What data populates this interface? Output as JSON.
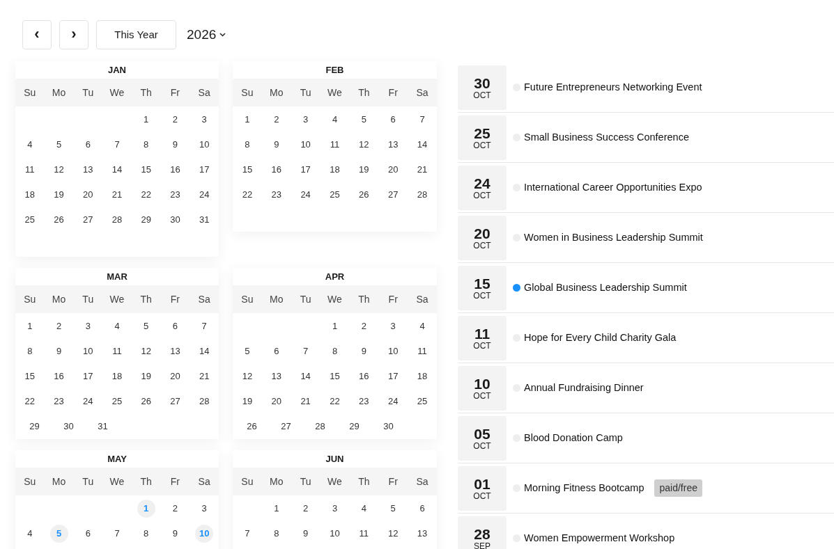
{
  "toolbar": {
    "prev_label": "‹",
    "next_label": "›",
    "today_button": "This Year",
    "year": "2026"
  },
  "months": [
    {
      "name": "JAN",
      "weekdays": [
        "Su",
        "Mo",
        "Tu",
        "We",
        "Th",
        "Fr",
        "Sa"
      ],
      "weeks": [
        [
          {
            "d": "1",
            "marked": false
          },
          {
            "d": "2",
            "marked": false
          },
          {
            "d": "3",
            "marked": false
          }
        ],
        [
          {
            "d": "4",
            "marked": false
          },
          {
            "d": "5",
            "marked": false
          },
          {
            "d": "6",
            "marked": false
          },
          {
            "d": "7",
            "marked": false
          },
          {
            "d": "8",
            "marked": false
          },
          {
            "d": "9",
            "marked": false
          },
          {
            "d": "10",
            "marked": false
          }
        ],
        [
          {
            "d": "11",
            "marked": false
          },
          {
            "d": "12",
            "marked": false
          },
          {
            "d": "13",
            "marked": false
          },
          {
            "d": "14",
            "marked": false
          },
          {
            "d": "15",
            "marked": false
          },
          {
            "d": "16",
            "marked": false
          },
          {
            "d": "17",
            "marked": false
          }
        ],
        [
          {
            "d": "18",
            "marked": false
          },
          {
            "d": "19",
            "marked": false
          },
          {
            "d": "20",
            "marked": false
          },
          {
            "d": "21",
            "marked": false
          },
          {
            "d": "22",
            "marked": false
          },
          {
            "d": "23",
            "marked": false
          },
          {
            "d": "24",
            "marked": false
          }
        ],
        [
          {
            "d": "25",
            "marked": false
          },
          {
            "d": "26",
            "marked": false
          },
          {
            "d": "27",
            "marked": false
          },
          {
            "d": "28",
            "marked": false
          },
          {
            "d": "29",
            "marked": false
          },
          {
            "d": "30",
            "marked": false
          },
          {
            "d": "31",
            "marked": false
          }
        ]
      ]
    },
    {
      "name": "FEB",
      "weekdays": [
        "Su",
        "Mo",
        "Tu",
        "We",
        "Th",
        "Fr",
        "Sa"
      ],
      "weeks": [
        [
          {
            "d": "1",
            "marked": false
          },
          {
            "d": "2",
            "marked": false
          },
          {
            "d": "3",
            "marked": false
          },
          {
            "d": "4",
            "marked": false
          },
          {
            "d": "5",
            "marked": false
          },
          {
            "d": "6",
            "marked": false
          },
          {
            "d": "7",
            "marked": false
          }
        ],
        [
          {
            "d": "8",
            "marked": false
          },
          {
            "d": "9",
            "marked": false
          },
          {
            "d": "10",
            "marked": false
          },
          {
            "d": "11",
            "marked": false
          },
          {
            "d": "12",
            "marked": false
          },
          {
            "d": "13",
            "marked": false
          },
          {
            "d": "14",
            "marked": false
          }
        ],
        [
          {
            "d": "15",
            "marked": false
          },
          {
            "d": "16",
            "marked": false
          },
          {
            "d": "17",
            "marked": false
          },
          {
            "d": "18",
            "marked": false
          },
          {
            "d": "19",
            "marked": false
          },
          {
            "d": "20",
            "marked": false
          },
          {
            "d": "21",
            "marked": false
          }
        ],
        [
          {
            "d": "22",
            "marked": false
          },
          {
            "d": "23",
            "marked": false
          },
          {
            "d": "24",
            "marked": false
          },
          {
            "d": "25",
            "marked": false
          },
          {
            "d": "26",
            "marked": false
          },
          {
            "d": "27",
            "marked": false
          },
          {
            "d": "28",
            "marked": false
          }
        ]
      ]
    },
    {
      "name": "MAR",
      "weekdays": [
        "Su",
        "Mo",
        "Tu",
        "We",
        "Th",
        "Fr",
        "Sa"
      ],
      "weeks": [
        [
          {
            "d": "1",
            "marked": false
          },
          {
            "d": "2",
            "marked": false
          },
          {
            "d": "3",
            "marked": false
          },
          {
            "d": "4",
            "marked": false
          },
          {
            "d": "5",
            "marked": false
          },
          {
            "d": "6",
            "marked": false
          },
          {
            "d": "7",
            "marked": false
          }
        ],
        [
          {
            "d": "8",
            "marked": false
          },
          {
            "d": "9",
            "marked": false
          },
          {
            "d": "10",
            "marked": false
          },
          {
            "d": "11",
            "marked": false
          },
          {
            "d": "12",
            "marked": false
          },
          {
            "d": "13",
            "marked": false
          },
          {
            "d": "14",
            "marked": false
          }
        ],
        [
          {
            "d": "15",
            "marked": false
          },
          {
            "d": "16",
            "marked": false
          },
          {
            "d": "17",
            "marked": false
          },
          {
            "d": "18",
            "marked": false
          },
          {
            "d": "19",
            "marked": false
          },
          {
            "d": "20",
            "marked": false
          },
          {
            "d": "21",
            "marked": false
          }
        ],
        [
          {
            "d": "22",
            "marked": false
          },
          {
            "d": "23",
            "marked": false
          },
          {
            "d": "24",
            "marked": false
          },
          {
            "d": "25",
            "marked": false
          },
          {
            "d": "26",
            "marked": false
          },
          {
            "d": "27",
            "marked": false
          },
          {
            "d": "28",
            "marked": false
          }
        ],
        [
          {
            "d": "29",
            "marked": false
          },
          {
            "d": "30",
            "marked": false
          },
          {
            "d": "31",
            "marked": false
          }
        ]
      ]
    },
    {
      "name": "APR",
      "weekdays": [
        "Su",
        "Mo",
        "Tu",
        "We",
        "Th",
        "Fr",
        "Sa"
      ],
      "weeks": [
        [
          {
            "d": "1",
            "marked": false
          },
          {
            "d": "2",
            "marked": false
          },
          {
            "d": "3",
            "marked": false
          },
          {
            "d": "4",
            "marked": false
          }
        ],
        [
          {
            "d": "5",
            "marked": false
          },
          {
            "d": "6",
            "marked": false
          },
          {
            "d": "7",
            "marked": false
          },
          {
            "d": "8",
            "marked": false
          },
          {
            "d": "9",
            "marked": false
          },
          {
            "d": "10",
            "marked": false
          },
          {
            "d": "11",
            "marked": false
          }
        ],
        [
          {
            "d": "12",
            "marked": false
          },
          {
            "d": "13",
            "marked": false
          },
          {
            "d": "14",
            "marked": false
          },
          {
            "d": "15",
            "marked": false
          },
          {
            "d": "16",
            "marked": false
          },
          {
            "d": "17",
            "marked": false
          },
          {
            "d": "18",
            "marked": false
          }
        ],
        [
          {
            "d": "19",
            "marked": false
          },
          {
            "d": "20",
            "marked": false
          },
          {
            "d": "21",
            "marked": false
          },
          {
            "d": "22",
            "marked": false
          },
          {
            "d": "23",
            "marked": false
          },
          {
            "d": "24",
            "marked": false
          },
          {
            "d": "25",
            "marked": false
          }
        ],
        [
          {
            "d": "26",
            "marked": false
          },
          {
            "d": "27",
            "marked": false
          },
          {
            "d": "28",
            "marked": false
          },
          {
            "d": "29",
            "marked": false
          },
          {
            "d": "30",
            "marked": false
          }
        ]
      ]
    },
    {
      "name": "MAY",
      "weekdays": [
        "Su",
        "Mo",
        "Tu",
        "We",
        "Th",
        "Fr",
        "Sa"
      ],
      "weeks": [
        [
          {
            "d": "1",
            "marked": true
          },
          {
            "d": "2",
            "marked": false
          },
          {
            "d": "3",
            "marked": false
          }
        ],
        [
          {
            "d": "4",
            "marked": false
          },
          {
            "d": "5",
            "marked": true
          },
          {
            "d": "6",
            "marked": false
          },
          {
            "d": "7",
            "marked": false
          },
          {
            "d": "8",
            "marked": false
          },
          {
            "d": "9",
            "marked": false
          },
          {
            "d": "10",
            "marked": true
          }
        ]
      ]
    },
    {
      "name": "JUN",
      "weekdays": [
        "Su",
        "Mo",
        "Tu",
        "We",
        "Th",
        "Fr",
        "Sa"
      ],
      "weeks": [
        [
          {
            "d": "1",
            "marked": false
          },
          {
            "d": "2",
            "marked": false
          },
          {
            "d": "3",
            "marked": false
          },
          {
            "d": "4",
            "marked": false
          },
          {
            "d": "5",
            "marked": false
          },
          {
            "d": "6",
            "marked": false
          }
        ],
        [
          {
            "d": "7",
            "marked": false
          },
          {
            "d": "8",
            "marked": false
          },
          {
            "d": "9",
            "marked": false
          },
          {
            "d": "10",
            "marked": false
          },
          {
            "d": "11",
            "marked": false
          },
          {
            "d": "12",
            "marked": false
          },
          {
            "d": "13",
            "marked": false
          }
        ]
      ]
    }
  ],
  "events": [
    {
      "day": "30",
      "month": "OCT",
      "title": "Future Entrepreneurs Networking Event",
      "color": "#eeeeee"
    },
    {
      "day": "25",
      "month": "OCT",
      "title": "Small Business Success Conference",
      "color": "#eeeeee"
    },
    {
      "day": "24",
      "month": "OCT",
      "title": "International Career Opportunities Expo",
      "color": "#eeeeee"
    },
    {
      "day": "20",
      "month": "OCT",
      "title": "Women in Business Leadership Summit",
      "color": "#eeeeee"
    },
    {
      "day": "15",
      "month": "OCT",
      "title": "Global Business Leadership Summit",
      "color": "#1890ff"
    },
    {
      "day": "11",
      "month": "OCT",
      "title": "Hope for Every Child Charity Gala",
      "color": "#eeeeee"
    },
    {
      "day": "10",
      "month": "OCT",
      "title": "Annual Fundraising Dinner",
      "color": "#eeeeee"
    },
    {
      "day": "05",
      "month": "OCT",
      "title": "Blood Donation Camp",
      "color": "#eeeeee"
    },
    {
      "day": "01",
      "month": "OCT",
      "title": "Morning Fitness Bootcamp",
      "color": "#eeeeee",
      "badge": "paid/free"
    },
    {
      "day": "28",
      "month": "SEP",
      "title": "Women Empowerment Workshop",
      "color": "#eeeeee"
    }
  ]
}
